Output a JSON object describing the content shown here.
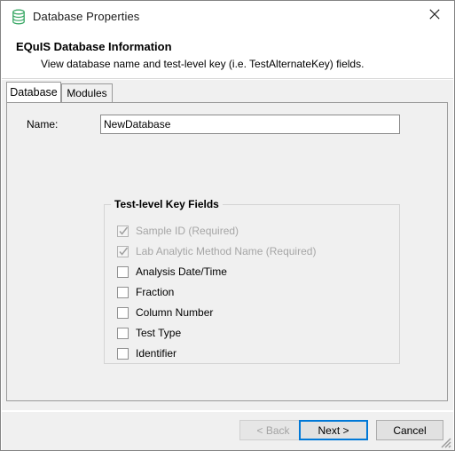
{
  "window": {
    "title": "Database Properties",
    "icon": "database-icon",
    "close_label": "close-icon"
  },
  "header": {
    "title": "EQuIS Database Information",
    "subtitle": "View database name and test-level key (i.e. TestAlternateKey) fields."
  },
  "tabs": [
    {
      "label": "Database",
      "selected": true
    },
    {
      "label": "Modules",
      "selected": false
    }
  ],
  "form": {
    "name_label": "Name:",
    "name_value": "NewDatabase",
    "name_placeholder": ""
  },
  "group": {
    "title": "Test-level Key Fields",
    "fields": [
      {
        "label": "Sample ID (Required)",
        "checked": true,
        "disabled": true
      },
      {
        "label": "Lab Analytic Method Name (Required)",
        "checked": true,
        "disabled": true
      },
      {
        "label": "Analysis Date/Time",
        "checked": false,
        "disabled": false
      },
      {
        "label": "Fraction",
        "checked": false,
        "disabled": false
      },
      {
        "label": "Column Number",
        "checked": false,
        "disabled": false
      },
      {
        "label": "Test Type",
        "checked": false,
        "disabled": false
      },
      {
        "label": "Identifier",
        "checked": false,
        "disabled": false
      }
    ]
  },
  "footer": {
    "back_label": "< Back",
    "next_label": "Next >",
    "cancel_label": "Cancel"
  },
  "colors": {
    "accent": "#0078d7",
    "icon_green": "#3aa866",
    "panel": "#f0f0f0",
    "disabled_text": "#a6a6a6"
  }
}
